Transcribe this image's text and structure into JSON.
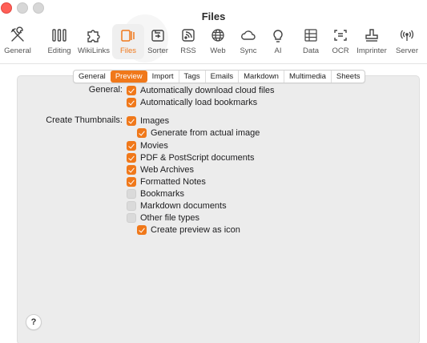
{
  "window": {
    "title": "Files"
  },
  "toolbar": {
    "items": [
      {
        "label": "General",
        "icon": "tools-icon"
      },
      {
        "label": "Editing",
        "icon": "pencils-icon"
      },
      {
        "label": "WikiLinks",
        "icon": "puzzle-icon"
      },
      {
        "label": "Files",
        "icon": "files-icon"
      },
      {
        "label": "Sorter",
        "icon": "sorter-icon"
      },
      {
        "label": "RSS",
        "icon": "rss-icon"
      },
      {
        "label": "Web",
        "icon": "globe-icon"
      },
      {
        "label": "Sync",
        "icon": "cloud-icon"
      },
      {
        "label": "AI",
        "icon": "lightbulb-icon"
      },
      {
        "label": "Data",
        "icon": "data-grid-icon"
      },
      {
        "label": "OCR",
        "icon": "ocr-scan-icon"
      },
      {
        "label": "Imprinter",
        "icon": "stamp-icon"
      },
      {
        "label": "Server",
        "icon": "broadcast-icon"
      }
    ],
    "active": "Files"
  },
  "tabs": {
    "items": [
      "General",
      "Preview",
      "Import",
      "Tags",
      "Emails",
      "Markdown",
      "Multimedia",
      "Sheets"
    ],
    "active": "Preview"
  },
  "general_section": {
    "label": "General:",
    "options": [
      {
        "label": "Automatically download cloud files",
        "checked": true
      },
      {
        "label": "Automatically load bookmarks",
        "checked": true
      }
    ]
  },
  "thumbnails_section": {
    "label": "Create Thumbnails:",
    "options": [
      {
        "label": "Images",
        "checked": true
      },
      {
        "label": "Generate from actual image",
        "checked": true
      },
      {
        "label": "Movies",
        "checked": true
      },
      {
        "label": "PDF & PostScript documents",
        "checked": true
      },
      {
        "label": "Web Archives",
        "checked": true
      },
      {
        "label": "Formatted Notes",
        "checked": true
      },
      {
        "label": "Bookmarks",
        "checked": false
      },
      {
        "label": "Markdown documents",
        "checked": false
      },
      {
        "label": "Other file types",
        "checked": false
      },
      {
        "label": "Create preview as icon",
        "checked": true
      }
    ]
  },
  "help": {
    "label": "?"
  },
  "colors": {
    "accent": "#f0781a",
    "close": "#ff5f57"
  }
}
